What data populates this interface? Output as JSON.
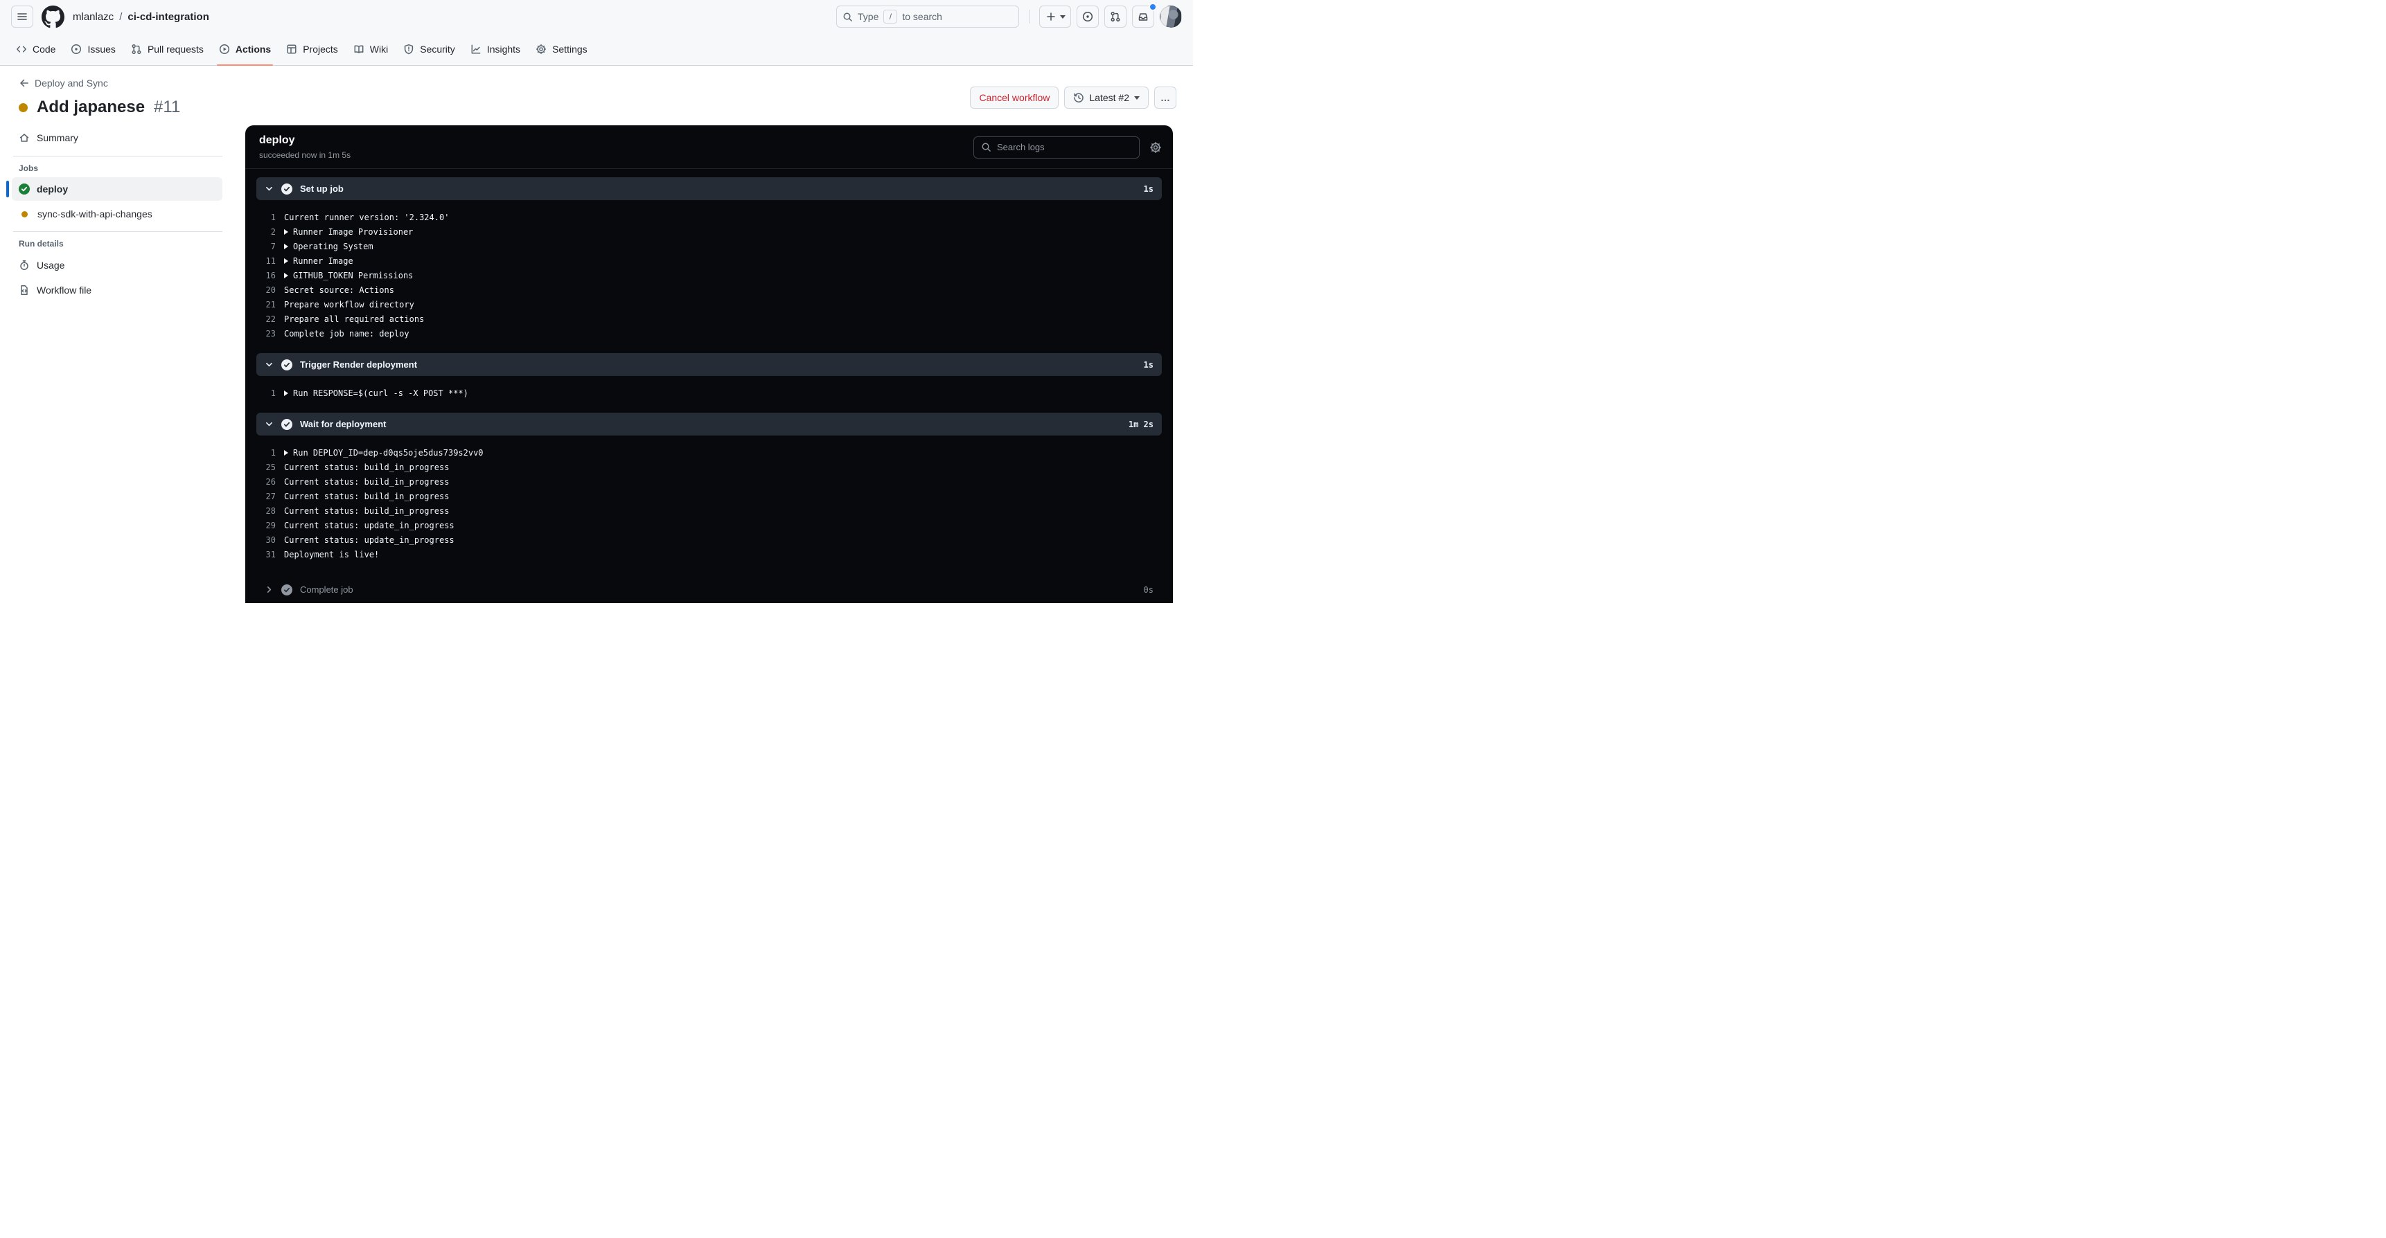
{
  "header": {
    "breadcrumb": {
      "owner": "mlanlazc",
      "separator": "/",
      "repo": "ci-cd-integration"
    },
    "search": {
      "prefix": "Type",
      "slash_key": "/",
      "suffix": "to search"
    }
  },
  "nav": {
    "items": [
      {
        "label": "Code",
        "icon": "code-icon",
        "active": false
      },
      {
        "label": "Issues",
        "icon": "issue-opened-icon",
        "active": false
      },
      {
        "label": "Pull requests",
        "icon": "git-pull-request-icon",
        "active": false
      },
      {
        "label": "Actions",
        "icon": "play-circle-icon",
        "active": true
      },
      {
        "label": "Projects",
        "icon": "table-icon",
        "active": false
      },
      {
        "label": "Wiki",
        "icon": "book-icon",
        "active": false
      },
      {
        "label": "Security",
        "icon": "shield-icon",
        "active": false
      },
      {
        "label": "Insights",
        "icon": "graph-icon",
        "active": false
      },
      {
        "label": "Settings",
        "icon": "gear-icon",
        "active": false
      }
    ]
  },
  "run": {
    "back_label": "Deploy and Sync",
    "title": "Add japanese",
    "number": "#11",
    "status": "in_progress",
    "actions": {
      "cancel_label": "Cancel workflow",
      "attempt_label": "Latest #2",
      "more_label": "…"
    }
  },
  "sidebar": {
    "summary_label": "Summary",
    "jobs_heading": "Jobs",
    "jobs": [
      {
        "name": "deploy",
        "status": "success",
        "selected": true
      },
      {
        "name": "sync-sdk-with-api-changes",
        "status": "in_progress",
        "selected": false
      }
    ],
    "run_details_heading": "Run details",
    "detail_items": [
      {
        "label": "Usage",
        "icon": "stopwatch-icon"
      },
      {
        "label": "Workflow file",
        "icon": "file-code-icon"
      }
    ]
  },
  "log_panel": {
    "job_name": "deploy",
    "status_line": "succeeded now in 1m 5s",
    "search_placeholder": "Search logs",
    "sections": [
      {
        "title": "Set up job",
        "duration": "1s",
        "status": "success",
        "expanded": true,
        "lines": [
          {
            "num": "1",
            "text": "Current runner version: '2.324.0'",
            "group": false
          },
          {
            "num": "2",
            "text": "Runner Image Provisioner",
            "group": true
          },
          {
            "num": "7",
            "text": "Operating System",
            "group": true
          },
          {
            "num": "11",
            "text": "Runner Image",
            "group": true
          },
          {
            "num": "16",
            "text": "GITHUB_TOKEN Permissions",
            "group": true
          },
          {
            "num": "20",
            "text": "Secret source: Actions",
            "group": false
          },
          {
            "num": "21",
            "text": "Prepare workflow directory",
            "group": false
          },
          {
            "num": "22",
            "text": "Prepare all required actions",
            "group": false
          },
          {
            "num": "23",
            "text": "Complete job name: deploy",
            "group": false
          }
        ]
      },
      {
        "title": "Trigger Render deployment",
        "duration": "1s",
        "status": "success",
        "expanded": true,
        "lines": [
          {
            "num": "1",
            "text": "Run RESPONSE=$(curl -s -X POST ***)",
            "group": true
          }
        ]
      },
      {
        "title": "Wait for deployment",
        "duration": "1m 2s",
        "status": "success",
        "expanded": true,
        "lines": [
          {
            "num": "1",
            "text": "Run DEPLOY_ID=dep-d0qs5oje5dus739s2vv0",
            "group": true
          },
          {
            "num": "25",
            "text": "Current status: build_in_progress",
            "group": false
          },
          {
            "num": "26",
            "text": "Current status: build_in_progress",
            "group": false
          },
          {
            "num": "27",
            "text": "Current status: build_in_progress",
            "group": false
          },
          {
            "num": "28",
            "text": "Current status: build_in_progress",
            "group": false
          },
          {
            "num": "29",
            "text": "Current status: update_in_progress",
            "group": false
          },
          {
            "num": "30",
            "text": "Current status: update_in_progress",
            "group": false
          },
          {
            "num": "31",
            "text": "Deployment is live!",
            "group": false
          }
        ]
      },
      {
        "title": "Complete job",
        "duration": "0s",
        "status": "success",
        "expanded": false,
        "lines": []
      }
    ]
  },
  "colors": {
    "accent_blue": "#0969da",
    "active_tab_underline": "#fd8c73",
    "danger_red": "#cf222e",
    "success_green": "#1a7f37",
    "pending_yellow": "#bf8700",
    "notification_blue": "#2f81f7",
    "panel_background": "#07090d",
    "panel_section_bar": "#262c36"
  }
}
